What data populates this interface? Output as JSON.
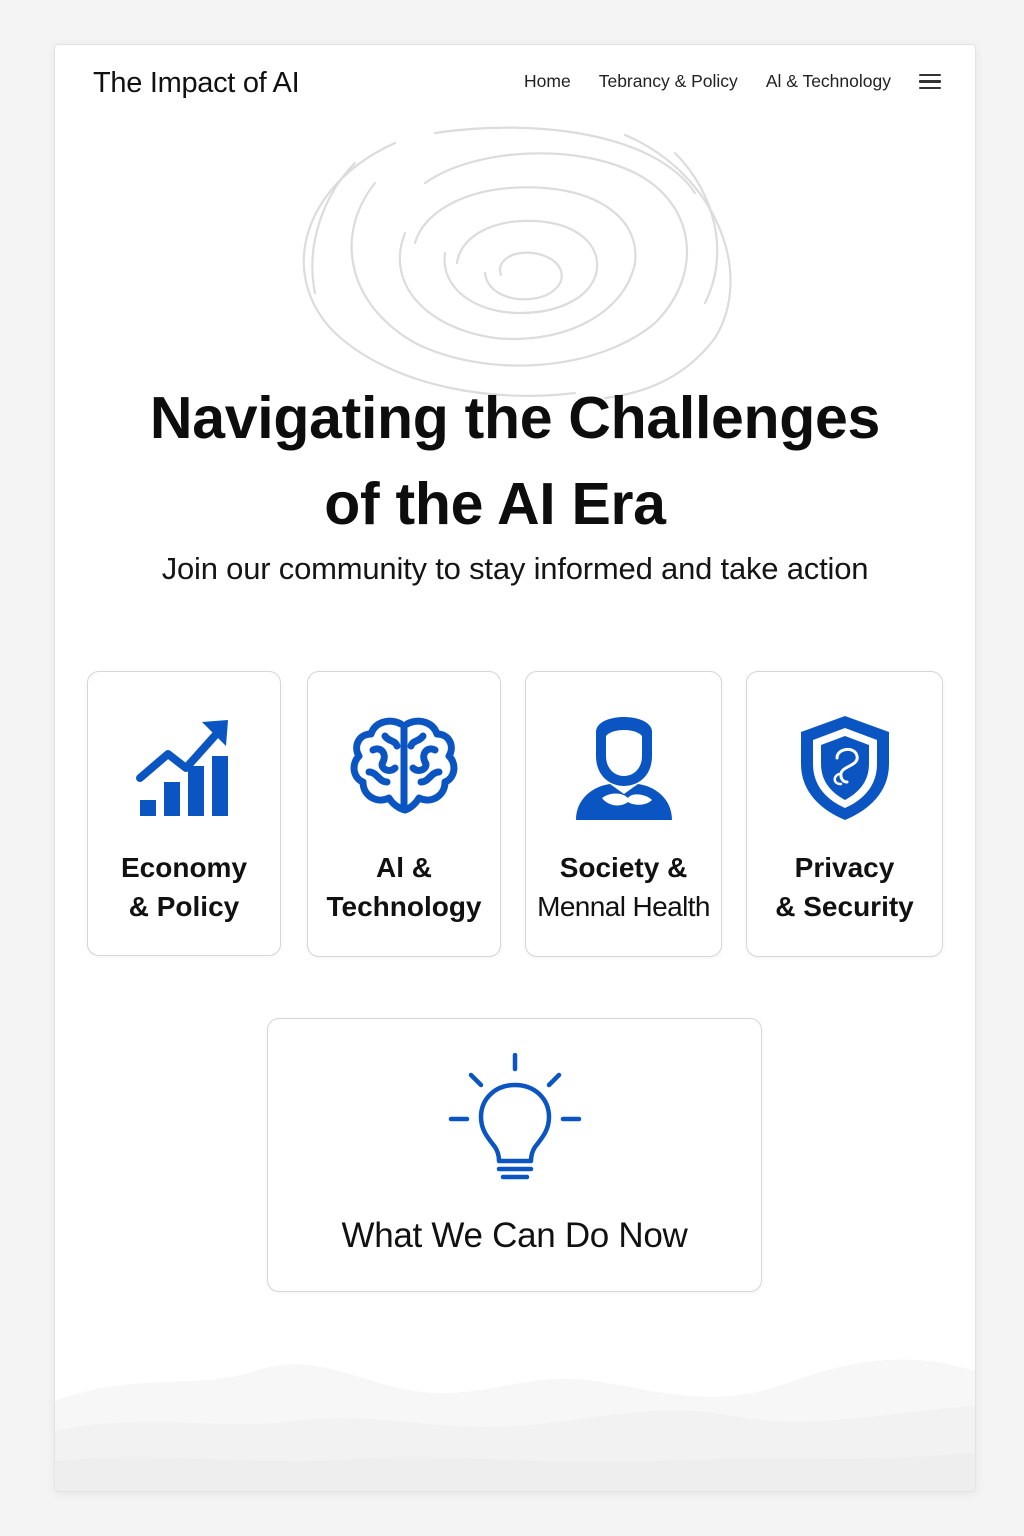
{
  "header": {
    "brand": "The Impact of AI",
    "nav": [
      {
        "label": "Home"
      },
      {
        "label": "Tebrancy & Policy"
      },
      {
        "label": "Al & Technology"
      }
    ],
    "menu_icon": "hamburger-menu-icon"
  },
  "hero": {
    "title_line1": "Navigating the Challenges",
    "title_line2": "of the AI Era",
    "subtitle": "Join our community to stay informed and take action"
  },
  "cards": [
    {
      "line1": "Economy",
      "line2": "& Policy",
      "icon": "growth-chart-icon"
    },
    {
      "line1": "Al &",
      "line2": "Technology",
      "icon": "brain-icon"
    },
    {
      "line1": "Society &",
      "line2": "Mennal Health",
      "icon": "person-icon"
    },
    {
      "line1": "Privacy",
      "line2": "& Security",
      "icon": "shield-icon"
    }
  ],
  "action_card": {
    "label": "What We Can Do Now",
    "icon": "lightbulb-icon"
  },
  "colors": {
    "accent": "#0a55c2",
    "text": "#111111",
    "border": "#d6d6d6",
    "page_bg": "#f4f4f4"
  }
}
